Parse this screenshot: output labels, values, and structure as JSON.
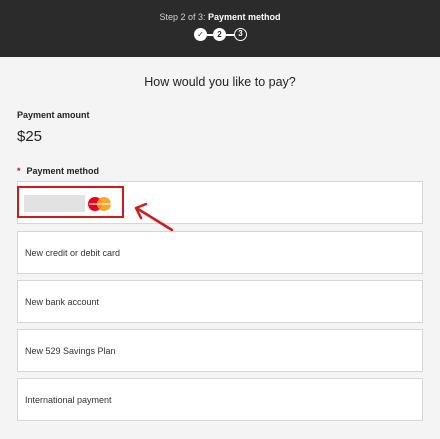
{
  "header": {
    "step_prefix": "Step 2 of 3:",
    "step_title": "Payment method",
    "steps": [
      "✓",
      "2",
      "3"
    ]
  },
  "heading": "How would you like to pay?",
  "payment_amount": {
    "label": "Payment amount",
    "value": "$25"
  },
  "payment_method": {
    "required_marker": "*",
    "label": "Payment method",
    "saved_card_brand_text": "mastercard",
    "options": [
      "New credit or debit card",
      "New bank account",
      "New 529 Savings Plan",
      "International payment"
    ]
  },
  "colors": {
    "header_bg": "#2b2b2b",
    "highlight": "#d11a1a",
    "required": "#c8102e"
  },
  "icons": [
    "check-icon",
    "mastercard-icon",
    "annotation-arrow-icon"
  ]
}
